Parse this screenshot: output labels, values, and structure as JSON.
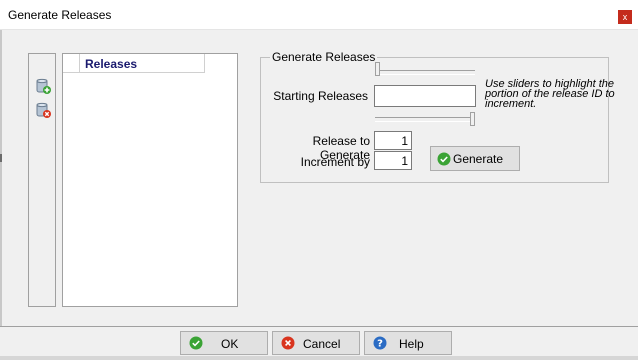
{
  "window": {
    "title": "Generate Releases",
    "close_glyph": "x"
  },
  "toolbar": {
    "add_icon": "add-database-icon",
    "delete_icon": "delete-database-icon"
  },
  "releases_list": {
    "header": "Releases",
    "items": []
  },
  "group": {
    "title": "Generate Releases",
    "starting_label": "Starting Releases",
    "starting_value": "",
    "hint": "Use sliders to highlight the portion of the release ID to increment.",
    "release_to_generate_label": "Release to Generate",
    "release_to_generate_value": "1",
    "increment_label": "Increment by",
    "increment_value": "1",
    "generate_button": "Generate"
  },
  "footer": {
    "ok": "OK",
    "cancel": "Cancel",
    "help": "Help"
  },
  "colors": {
    "close_red": "#c42b1c",
    "ok_green": "#3aa335",
    "cancel_red": "#d9341e",
    "help_blue": "#2b6cc4",
    "list_header_text": "#1a1a6e"
  }
}
